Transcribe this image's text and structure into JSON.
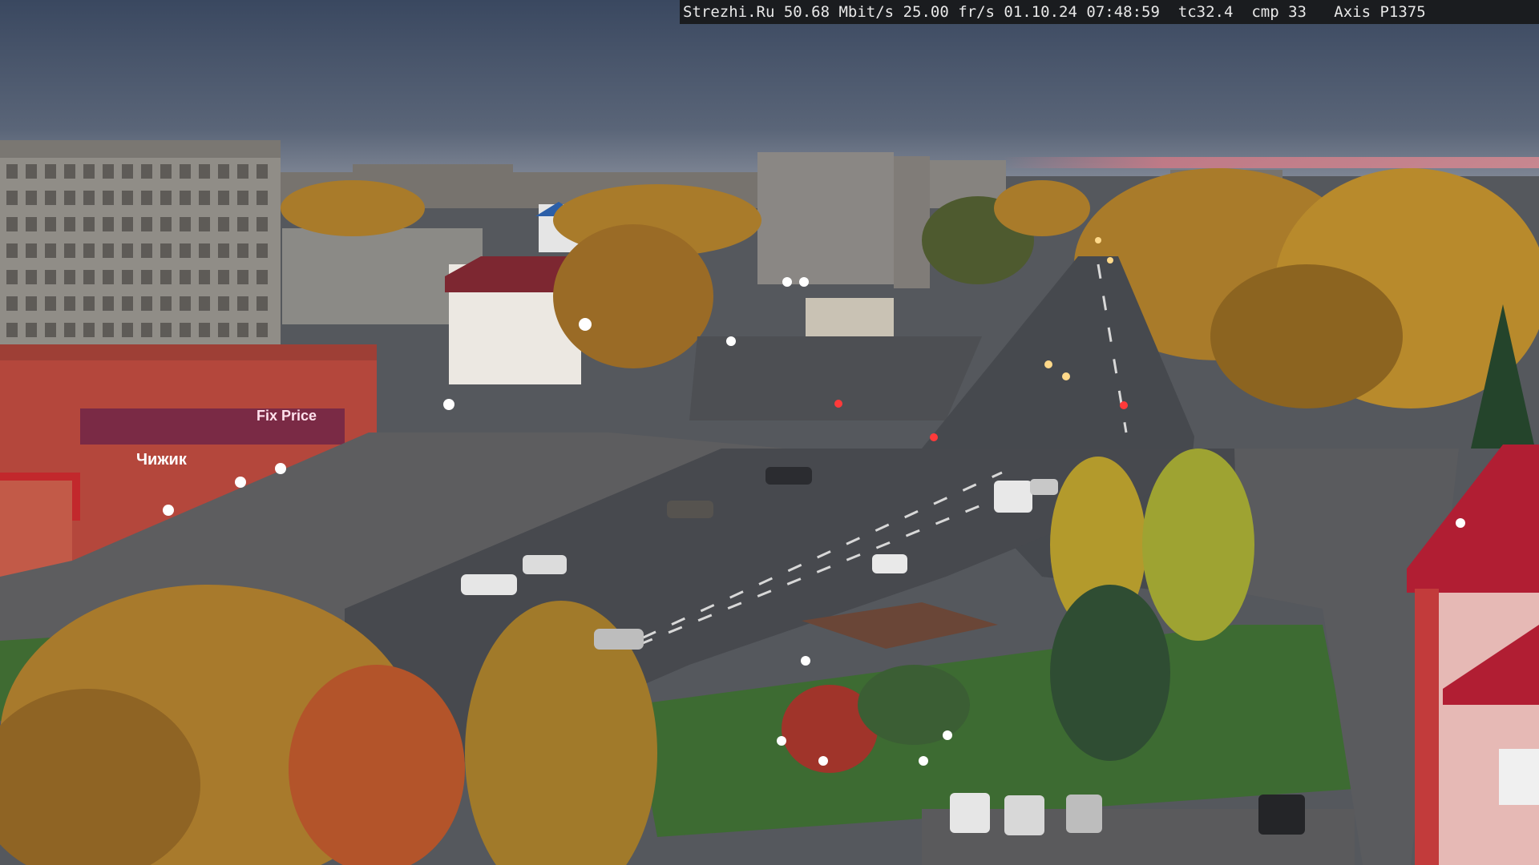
{
  "overlay": {
    "site": "Strezhi.Ru",
    "bitrate": "50.68 Mbit/s",
    "framerate": "25.00 fr/s",
    "date": "01.10.24",
    "time": "07:48:59",
    "tc": "tc32.4",
    "cmp": "cmp 33",
    "camera": "Axis P1375"
  },
  "signs": {
    "store_sign": "Чижик",
    "shop_sign_2": "Fix Price"
  },
  "colors": {
    "sky_top": "#3e4d63",
    "sky_horizon": "#7c8494",
    "sunrise_glow": "#c77a86",
    "asphalt": "#4a4d53",
    "foliage": "#b8892a",
    "foliage_dark": "#8c6420",
    "grass": "#3d6b32",
    "brick_red": "#b4473c",
    "panel_building": "#8f8c86",
    "roof_red": "#b11e33",
    "streetlight": "#ffffff"
  }
}
